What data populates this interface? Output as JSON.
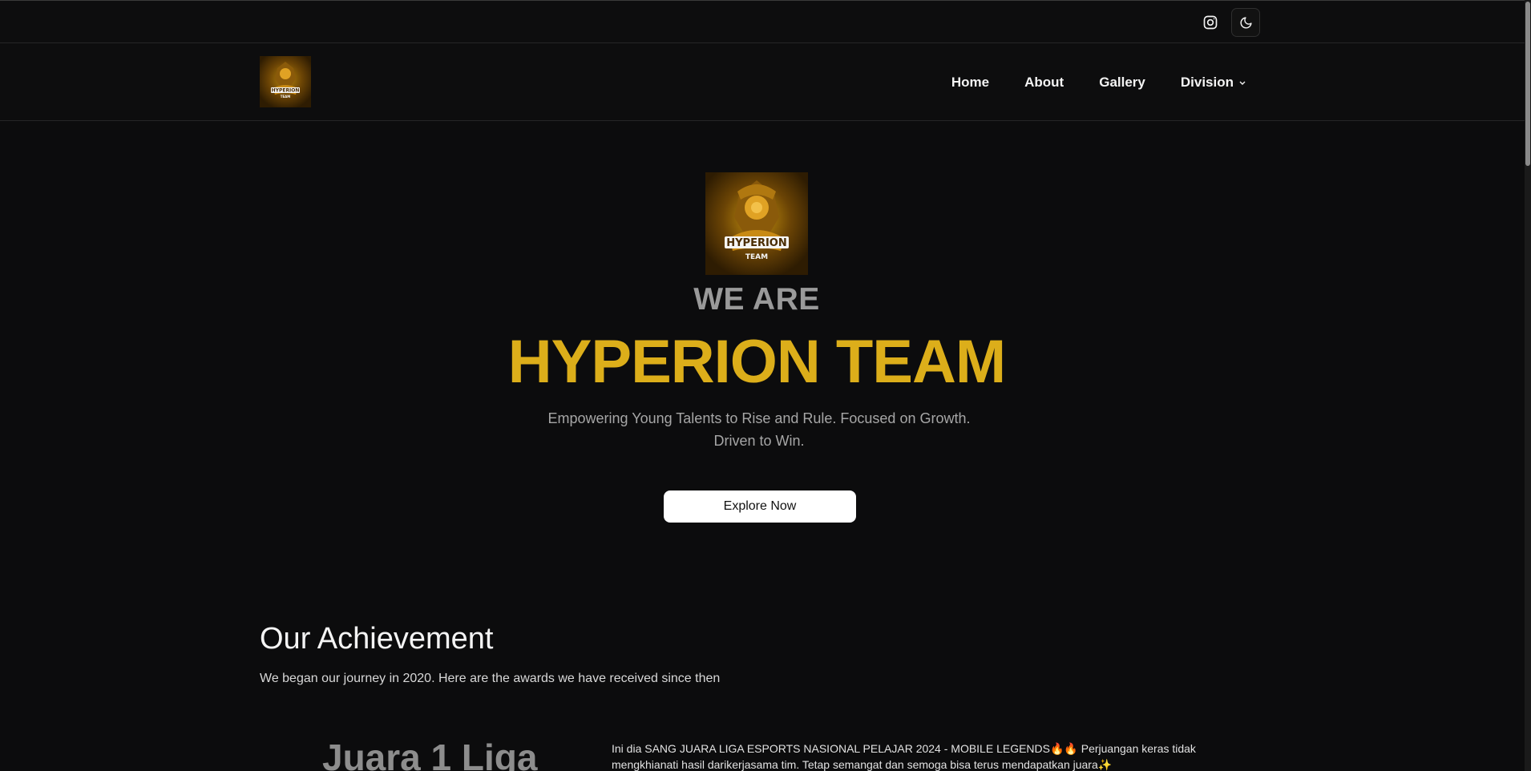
{
  "topbar": {
    "instagram_icon": "instagram-icon",
    "theme_icon": "moon-icon"
  },
  "nav": {
    "items": [
      {
        "label": "Home"
      },
      {
        "label": "About"
      },
      {
        "label": "Gallery"
      },
      {
        "label": "Division"
      }
    ]
  },
  "logo": {
    "wordmark_top": "HYPERION",
    "wordmark_bottom": "TEAM"
  },
  "hero": {
    "pre_title": "WE ARE",
    "title": "HYPERION TEAM",
    "tagline": "Empowering Young Talents to Rise and Rule. Focused on Growth. Driven to Win.",
    "cta_label": "Explore Now"
  },
  "achievements": {
    "title": "Our Achievement",
    "subtitle": "We began our journey in 2020. Here are the awards we have received since then",
    "items": [
      {
        "title": "Juara 1 Liga",
        "description": "Ini dia SANG JUARA LIGA ESPORTS NASIONAL PELAJAR 2024 - MOBILE LEGENDS🔥🔥 Perjuangan keras tidak mengkhianati hasil darikerjasama tim. Tetap semangat dan semoga bisa terus mendapatkan juara✨"
      }
    ]
  },
  "colors": {
    "background": "#0c0c0d",
    "accent_gold": "#dcae1a",
    "muted_gray": "#9a9a9a"
  }
}
